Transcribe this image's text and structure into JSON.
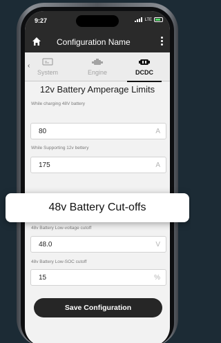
{
  "status_bar": {
    "time": "9:27",
    "network": "LTE"
  },
  "app_bar": {
    "title": "Configuration Name"
  },
  "tabs": [
    {
      "label": "System",
      "icon": "monitor-icon",
      "active": false
    },
    {
      "label": "Engine",
      "icon": "engine-icon",
      "active": false
    },
    {
      "label": "DCDC",
      "icon": "dcdc-converter-icon",
      "active": true
    }
  ],
  "amperage_section": {
    "title": "12v Battery Amperage Limits",
    "fields": [
      {
        "label": "While charging 48V battery",
        "value": "80",
        "unit": "A"
      },
      {
        "label": "While Supporting 12v bettery",
        "value": "175",
        "unit": "A"
      }
    ]
  },
  "cutoffs_section": {
    "title": "48v Battery Cut-offs",
    "fields": [
      {
        "label": "48v Battery Low-voltage cutoff",
        "value": "48.0",
        "unit": "V"
      },
      {
        "label": "48v Battery Low-SOC cutoff",
        "value": "15",
        "unit": "%"
      }
    ]
  },
  "save_button": {
    "label": "Save Configuration"
  },
  "colors": {
    "header": "#2a2a2a",
    "background": "#1c2b35",
    "battery": "#4cd964"
  }
}
